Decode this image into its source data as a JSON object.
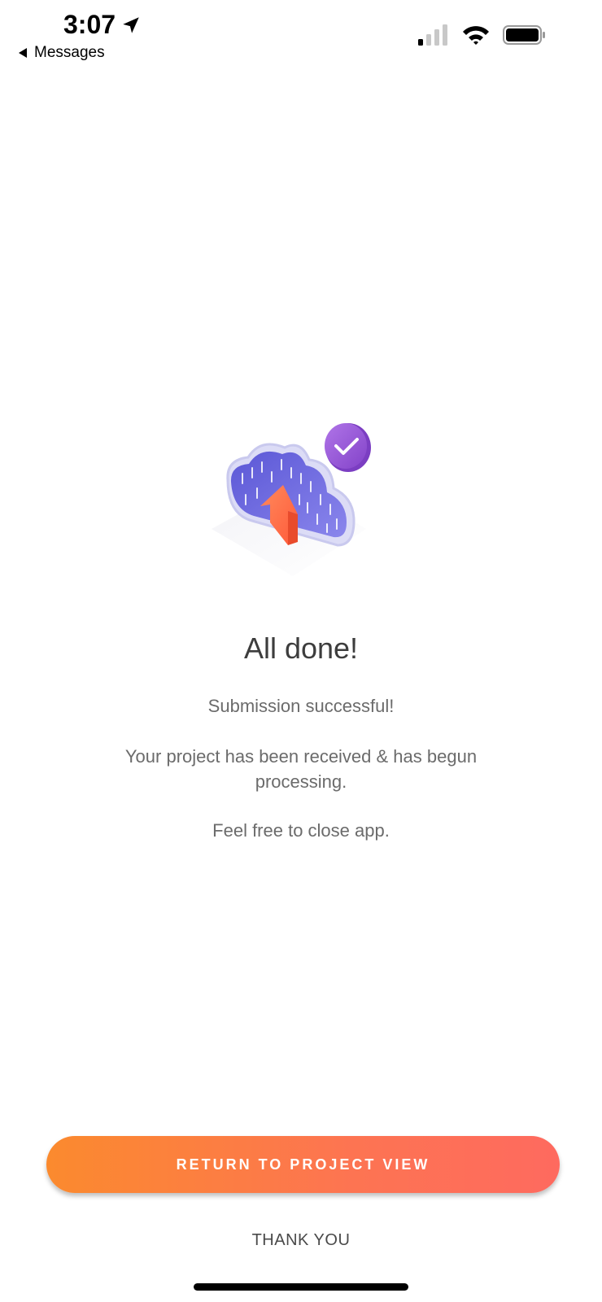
{
  "status_bar": {
    "time": "3:07",
    "back_label": "Messages"
  },
  "main": {
    "title": "All done!",
    "subtitle": "Submission successful!",
    "body": "Your project has been received & has begun processing.",
    "note": "Feel free to close app."
  },
  "actions": {
    "primary_label": "RETURN TO PROJECT VIEW",
    "secondary_label": "THANK YOU"
  },
  "colors": {
    "primary_gradient_start": "#fb8a2e",
    "primary_gradient_end": "#fe6a5f",
    "check_badge": "#9a55d6",
    "cloud": "#6a64dc",
    "arrow": "#ff6b4a"
  },
  "icons": {
    "location": "location-arrow-icon",
    "back": "back-triangle-icon",
    "signal": "cellular-signal-icon",
    "wifi": "wifi-icon",
    "battery": "battery-icon",
    "illustration": "cloud-upload-illustration",
    "check": "check-badge-icon"
  }
}
